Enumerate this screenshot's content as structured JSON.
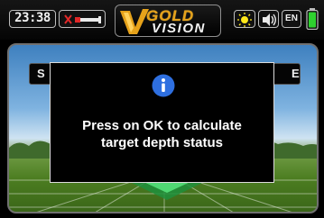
{
  "status_bar": {
    "clock": "23:38",
    "probe_icon": "probe-disconnected-icon",
    "light_icon": "light-icon",
    "sound_icon": "speaker-icon",
    "language": "EN",
    "battery_icon": "battery-icon",
    "battery_level": 0.9
  },
  "logo": {
    "line1": "GOLD",
    "line2": "VISION",
    "colors": {
      "gold": "#e6a21a",
      "vision": "#f3f3f3"
    }
  },
  "background_tabs": {
    "left_label": "S",
    "right_label": "E"
  },
  "dialog": {
    "icon": "info-icon",
    "message_line1": "Press on OK to calculate",
    "message_line2": "target depth status",
    "accent_color": "#2e6fe0"
  }
}
